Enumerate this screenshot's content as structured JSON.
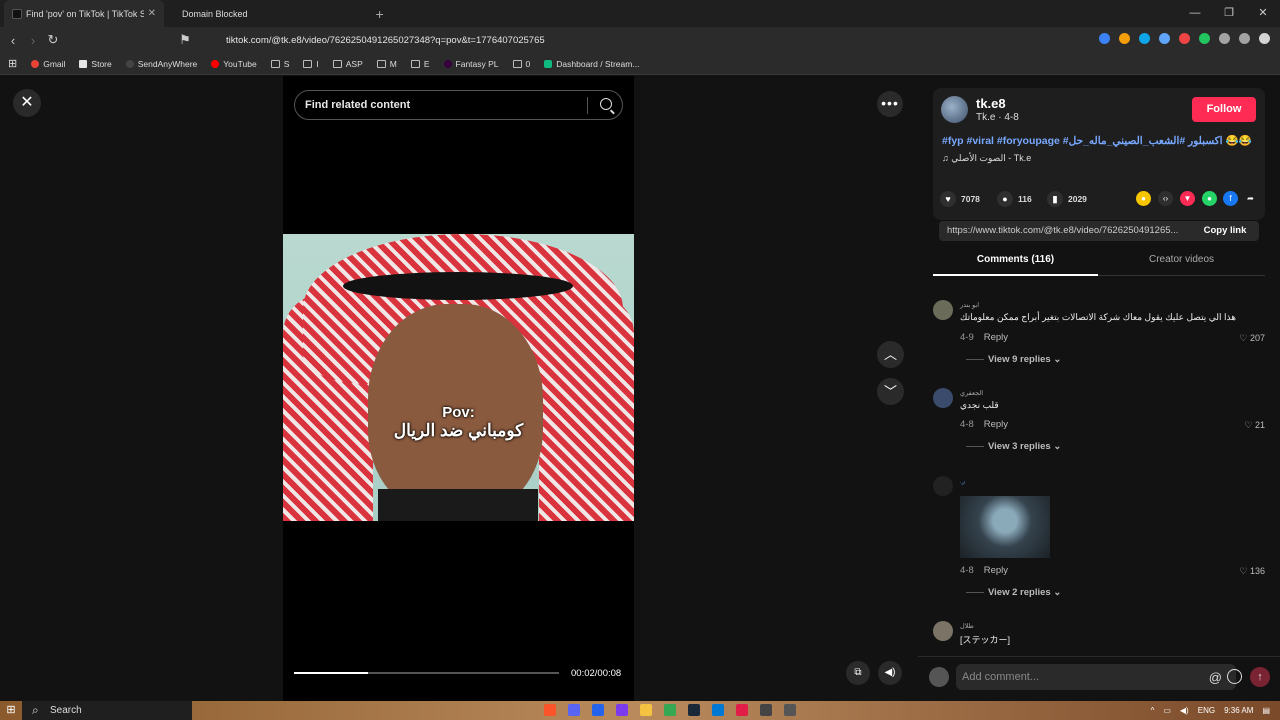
{
  "browser": {
    "tabs": [
      {
        "label": "Find 'pov' on TikTok | TikTok S",
        "active": true
      },
      {
        "label": "Domain Blocked",
        "active": false
      }
    ],
    "url": "tiktok.com/@tk.e8/video/7626250491265027348?q=pov&t=1776407025765",
    "bookmarks": [
      "Gmail",
      "Store",
      "SendAnyWhere",
      "YouTube",
      "S",
      "I",
      "ASP",
      "M",
      "E",
      "Fantasy PL",
      "0",
      "Dashboard / Stream..."
    ]
  },
  "video": {
    "search_placeholder": "Find related content",
    "caption_line1": "Pov:",
    "caption_line2": "كومباني ضد الريال",
    "time": "00:02/00:08",
    "progress": 0.28
  },
  "author": {
    "username": "tk.e8",
    "subtitle": "Tk.e · 4-8",
    "follow_label": "Follow",
    "description": "#fyp #viral #foryoupage #اكسبلور #الشعب_الصيني_ماله_حل 😂😂",
    "music": "الصوت الأصلي - Tk.e"
  },
  "stats": {
    "likes": "7078",
    "comments": "116",
    "saves": "2029"
  },
  "share": {
    "link": "https://www.tiktok.com/@tk.e8/video/7626250491265...",
    "copy_label": "Copy link"
  },
  "tabs": {
    "comments": "Comments (116)",
    "creator": "Creator videos"
  },
  "comments": [
    {
      "name": "ابو بندر",
      "text": "هذا الي يتصل عليك يقول معاك شركة الاتصالات بتغير أبراج ممكن معلوماتك",
      "date": "4-9",
      "reply": "Reply",
      "likes": "207",
      "view_replies": "View 9 replies"
    },
    {
      "name": "الجعفري",
      "text": "قلب نجدي",
      "date": "4-8",
      "reply": "Reply",
      "likes": "21",
      "view_replies": "View 3 replies"
    },
    {
      "name": ".ر",
      "text": "",
      "date": "4-8",
      "reply": "Reply",
      "likes": "136",
      "view_replies": "View 2 replies"
    },
    {
      "name": "طلال",
      "text": "[ステッカー]",
      "date": "",
      "reply": "",
      "likes": "",
      "view_replies": ""
    }
  ],
  "add_comment_placeholder": "Add comment...",
  "taskbar": {
    "search": "Search",
    "lang": "ENG",
    "time": "9:36 AM"
  }
}
